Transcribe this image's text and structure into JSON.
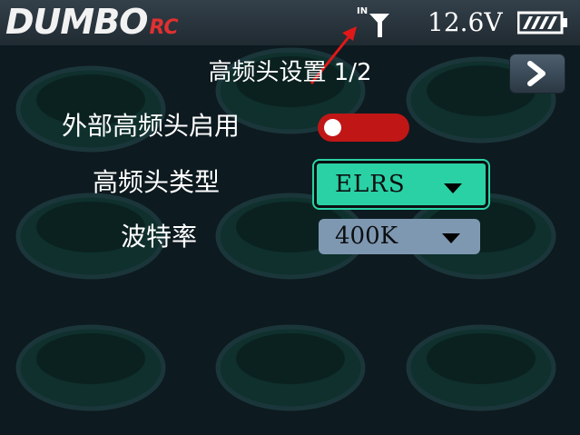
{
  "header": {
    "logo_text": "DUMBO",
    "logo_suffix": "RC",
    "antenna_label": "IN",
    "voltage": "12.6V",
    "battery_icon": "battery-full-icon"
  },
  "page": {
    "title": "高频头设置 1/2",
    "next_icon": "chevron-right-icon"
  },
  "settings": {
    "external_rf": {
      "label": "外部高频头启用",
      "enabled": false
    },
    "rf_type": {
      "label": "高频头类型",
      "value": "ELRS"
    },
    "baud_rate": {
      "label": "波特率",
      "value": "400K"
    }
  },
  "colors": {
    "accent": "#2ad1a4",
    "toggle_off": "#c01616",
    "select_bg": "#7f98b2",
    "logo_red": "#e03030"
  }
}
